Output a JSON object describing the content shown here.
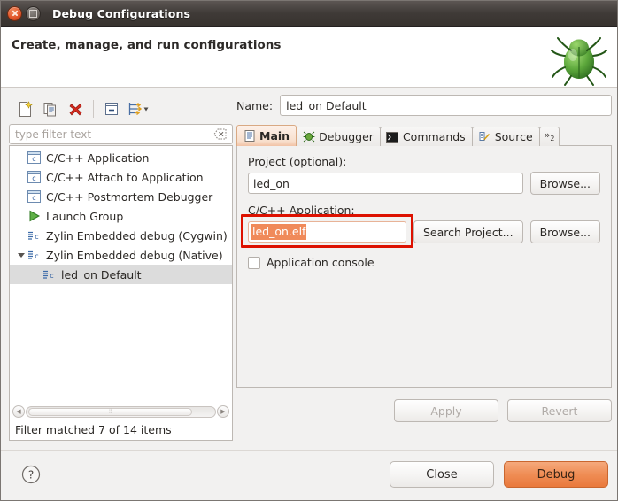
{
  "window": {
    "title": "Debug Configurations",
    "close_icon": "close-icon",
    "maximize_icon": "maximize-icon"
  },
  "header": {
    "title": "Create, manage, and run configurations",
    "icon": "bug-icon"
  },
  "toolbar": {
    "buttons": [
      {
        "name": "new-launch-configuration",
        "icon": "new-document-icon"
      },
      {
        "name": "duplicate-configuration",
        "icon": "copy-icon"
      },
      {
        "name": "delete-configuration",
        "icon": "delete-red-x-icon"
      },
      {
        "name": "collapse-all",
        "icon": "collapse-all-icon"
      },
      {
        "name": "filter-configurations",
        "icon": "filter-arrows-icon"
      }
    ]
  },
  "filter": {
    "placeholder": "type filter text",
    "value": "",
    "clear_icon": "clear-icon",
    "status": "Filter matched 7 of 14 items"
  },
  "tree": {
    "items": [
      {
        "label": "C/C++ Application",
        "icon": "c-app-icon",
        "level": 0,
        "expandable": false,
        "selected": false
      },
      {
        "label": "C/C++ Attach to Application",
        "icon": "c-app-icon",
        "level": 0,
        "expandable": false,
        "selected": false
      },
      {
        "label": "C/C++ Postmortem Debugger",
        "icon": "c-app-icon",
        "level": 0,
        "expandable": false,
        "selected": false
      },
      {
        "label": "Launch Group",
        "icon": "launch-group-icon",
        "level": 0,
        "expandable": false,
        "selected": false
      },
      {
        "label": "Zylin Embedded debug (Cygwin)",
        "icon": "zylin-icon",
        "level": 0,
        "expandable": false,
        "selected": false
      },
      {
        "label": "Zylin Embedded debug (Native)",
        "icon": "zylin-icon",
        "level": 0,
        "expandable": true,
        "expanded": true,
        "selected": false
      },
      {
        "label": "led_on Default",
        "icon": "zylin-icon",
        "level": 1,
        "expandable": false,
        "selected": true
      }
    ]
  },
  "config": {
    "name_label": "Name:",
    "name_value": "led_on Default",
    "tabs": [
      {
        "label": "Main",
        "icon": "document-icon",
        "active": true
      },
      {
        "label": "Debugger",
        "icon": "debugger-icon",
        "active": false
      },
      {
        "label": "Commands",
        "icon": "terminal-icon",
        "active": false
      },
      {
        "label": "Source",
        "icon": "source-icon",
        "active": false
      }
    ],
    "tab_overflow": "»",
    "tab_overflow_count": "2",
    "project_label": "Project (optional):",
    "project_value": "led_on",
    "project_browse_label": "Browse...",
    "application_label": "C/C++ Application:",
    "application_value": "led_on.elf",
    "application_search_label": "Search Project...",
    "application_browse_label": "Browse...",
    "console_checkbox_label": "Application console",
    "console_checked": false,
    "apply_label": "Apply",
    "apply_enabled": false,
    "revert_label": "Revert",
    "revert_enabled": false
  },
  "footer": {
    "help_icon": "help-icon",
    "close_label": "Close",
    "debug_label": "Debug"
  },
  "colors": {
    "accent_orange": "#ef8d55",
    "annotation_red": "#dd1100",
    "selection_orange": "#f08a5a",
    "titlebar_dark": "#3f3a37"
  }
}
